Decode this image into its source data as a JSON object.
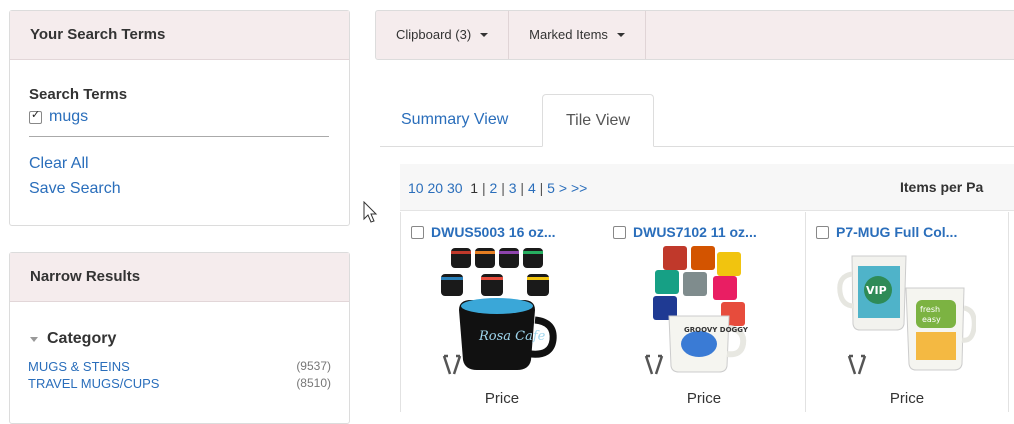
{
  "search_panel": {
    "header": "Your Search Terms",
    "terms_title": "Search Terms",
    "terms": [
      {
        "label": "mugs",
        "checked": true
      }
    ],
    "clear_all": "Clear All",
    "save_search": "Save Search"
  },
  "narrow_panel": {
    "header": "Narrow Results",
    "category_title": "Category",
    "categories": [
      {
        "label": "MUGS & STEINS",
        "count": "(9537)"
      },
      {
        "label": "TRAVEL MUGS/CUPS",
        "count": "(8510)"
      }
    ]
  },
  "toolbar": {
    "clipboard": "Clipboard (3)",
    "marked_items": "Marked Items"
  },
  "tabs": {
    "summary": "Summary View",
    "tile": "Tile View",
    "active": "tile"
  },
  "pagination": {
    "per_page_options": [
      "10",
      "20",
      "30"
    ],
    "pages": [
      "1",
      "2",
      "3",
      "4",
      "5"
    ],
    "current": "1",
    "next": ">",
    "last": ">>",
    "items_per_page_label": "Items per Pa"
  },
  "products": [
    {
      "title": "DWUS5003  16 oz...",
      "price_label": "Price",
      "image": "black-mugs-icon"
    },
    {
      "title": "DWUS7102  11 oz...",
      "price_label": "Price",
      "image": "colored-mugs-icon"
    },
    {
      "title": "P7-MUG  Full Col...",
      "price_label": "Price",
      "image": "full-color-mugs-icon"
    }
  ],
  "colors": {
    "link": "#2a6ebb",
    "panel_header_bg": "#f5eced"
  }
}
